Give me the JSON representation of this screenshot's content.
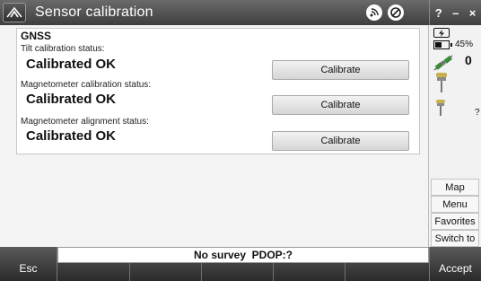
{
  "window": {
    "title": "Sensor calibration",
    "title_icons": [
      "signal-icon",
      "cancel-icon"
    ],
    "right_controls": [
      "?",
      "–",
      "×"
    ]
  },
  "panel": {
    "group_title": "GNSS",
    "rows": [
      {
        "label": "Tilt calibration status:",
        "status": "Calibrated OK",
        "button": "Calibrate"
      },
      {
        "label": "Magnetometer calibration status:",
        "status": "Calibrated OK",
        "button": "Calibrate"
      },
      {
        "label": "Magnetometer alignment status:",
        "status": "Calibrated OK",
        "button": "Calibrate"
      }
    ]
  },
  "sidebar": {
    "battery_percent": "45%",
    "satellite_count": "0",
    "rover_status": "?",
    "buttons": [
      "Map",
      "Menu",
      "Favorites",
      "Switch to"
    ]
  },
  "statusbar": {
    "text": "No survey  PDOP:?"
  },
  "bottom": {
    "esc_label": "Esc",
    "accept_label": "Accept"
  }
}
